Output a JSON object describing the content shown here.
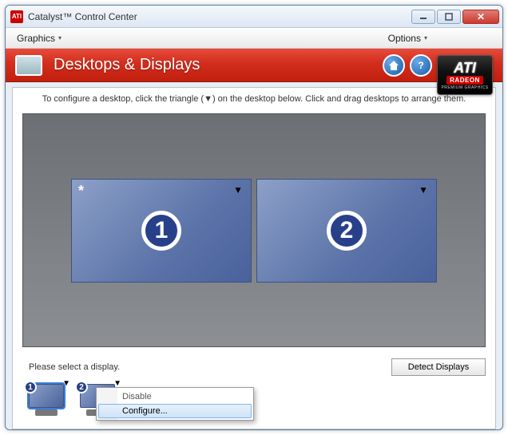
{
  "title_bar": {
    "app_icon_label": "ATI",
    "title": "Catalyst™ Control Center"
  },
  "menubar": {
    "graphics": "Graphics",
    "options": "Options"
  },
  "ati_box": {
    "brand": "ATI",
    "sub_brand": "RADEON",
    "tag": "PREMIUM GRAPHICS"
  },
  "red_bar": {
    "section_title": "Desktops & Displays"
  },
  "instruction": "To configure a desktop, click the triangle (▼) on the desktop below.  Click and drag desktops to arrange them.",
  "desktops": [
    {
      "number": "1",
      "primary": true
    },
    {
      "number": "2",
      "primary": false
    }
  ],
  "lower": {
    "hint": "Please select a display.",
    "detect": "Detect Displays"
  },
  "thumbs": [
    {
      "badge": "1",
      "selected": true
    },
    {
      "badge": "2",
      "selected": false
    }
  ],
  "context_menu": {
    "items": [
      {
        "label": "Disable",
        "enabled": false,
        "hover": false
      },
      {
        "label": "Configure...",
        "enabled": true,
        "hover": true
      }
    ]
  }
}
